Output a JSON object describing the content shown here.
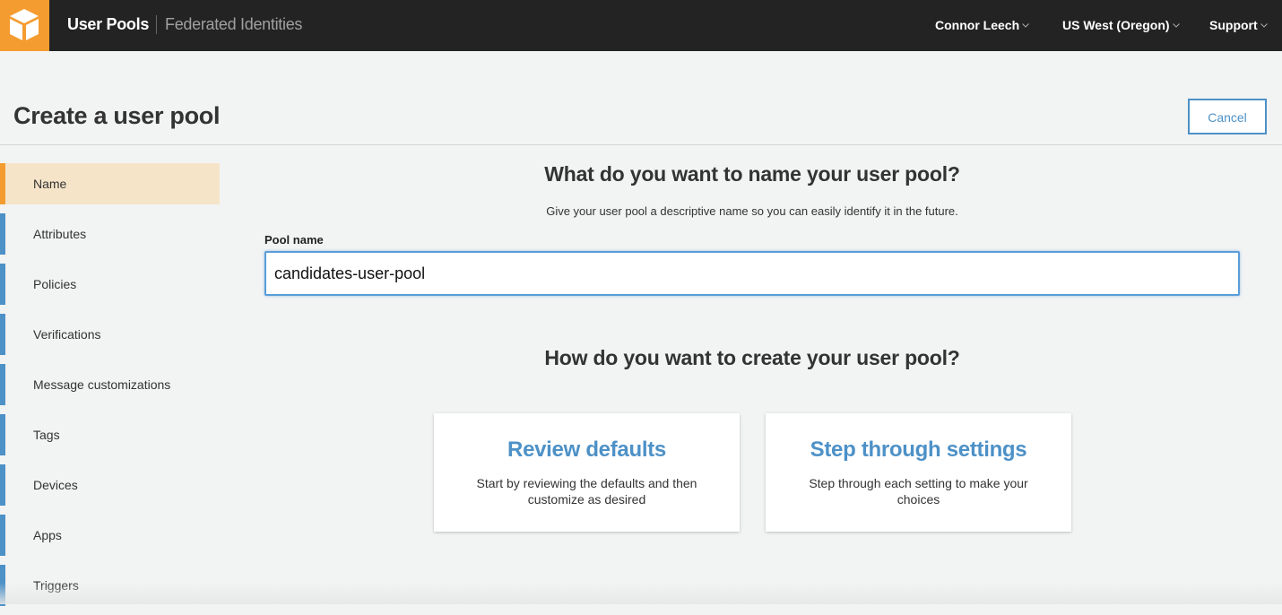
{
  "topbar": {
    "logo_icon": "aws-cube-icon",
    "brand_primary": "User Pools",
    "brand_secondary": "Federated Identities",
    "user_menu": "Connor Leech",
    "region_menu": "US West (Oregon)",
    "support_menu": "Support"
  },
  "header": {
    "title": "Create a user pool",
    "cancel_label": "Cancel"
  },
  "sidebar": {
    "steps": [
      {
        "label": "Name",
        "active": true
      },
      {
        "label": "Attributes"
      },
      {
        "label": "Policies"
      },
      {
        "label": "Verifications"
      },
      {
        "label": "Message customizations"
      },
      {
        "label": "Tags"
      },
      {
        "label": "Devices"
      },
      {
        "label": "Apps"
      },
      {
        "label": "Triggers"
      }
    ]
  },
  "main": {
    "name_question": "What do you want to name your user pool?",
    "name_hint": "Give your user pool a descriptive name so you can easily identify it in the future.",
    "pool_name_label": "Pool name",
    "pool_name_value": "candidates-user-pool",
    "create_question": "How do you want to create your user pool?",
    "options": [
      {
        "title": "Review defaults",
        "description": "Start by reviewing the defaults and then customize as desired"
      },
      {
        "title": "Step through settings",
        "description": "Step through each setting to make your choices"
      }
    ]
  },
  "colors": {
    "accent_orange": "#f49c30",
    "link_blue": "#4d91c7",
    "topbar_bg": "#232323",
    "active_step_bg": "#f5e4c8"
  }
}
